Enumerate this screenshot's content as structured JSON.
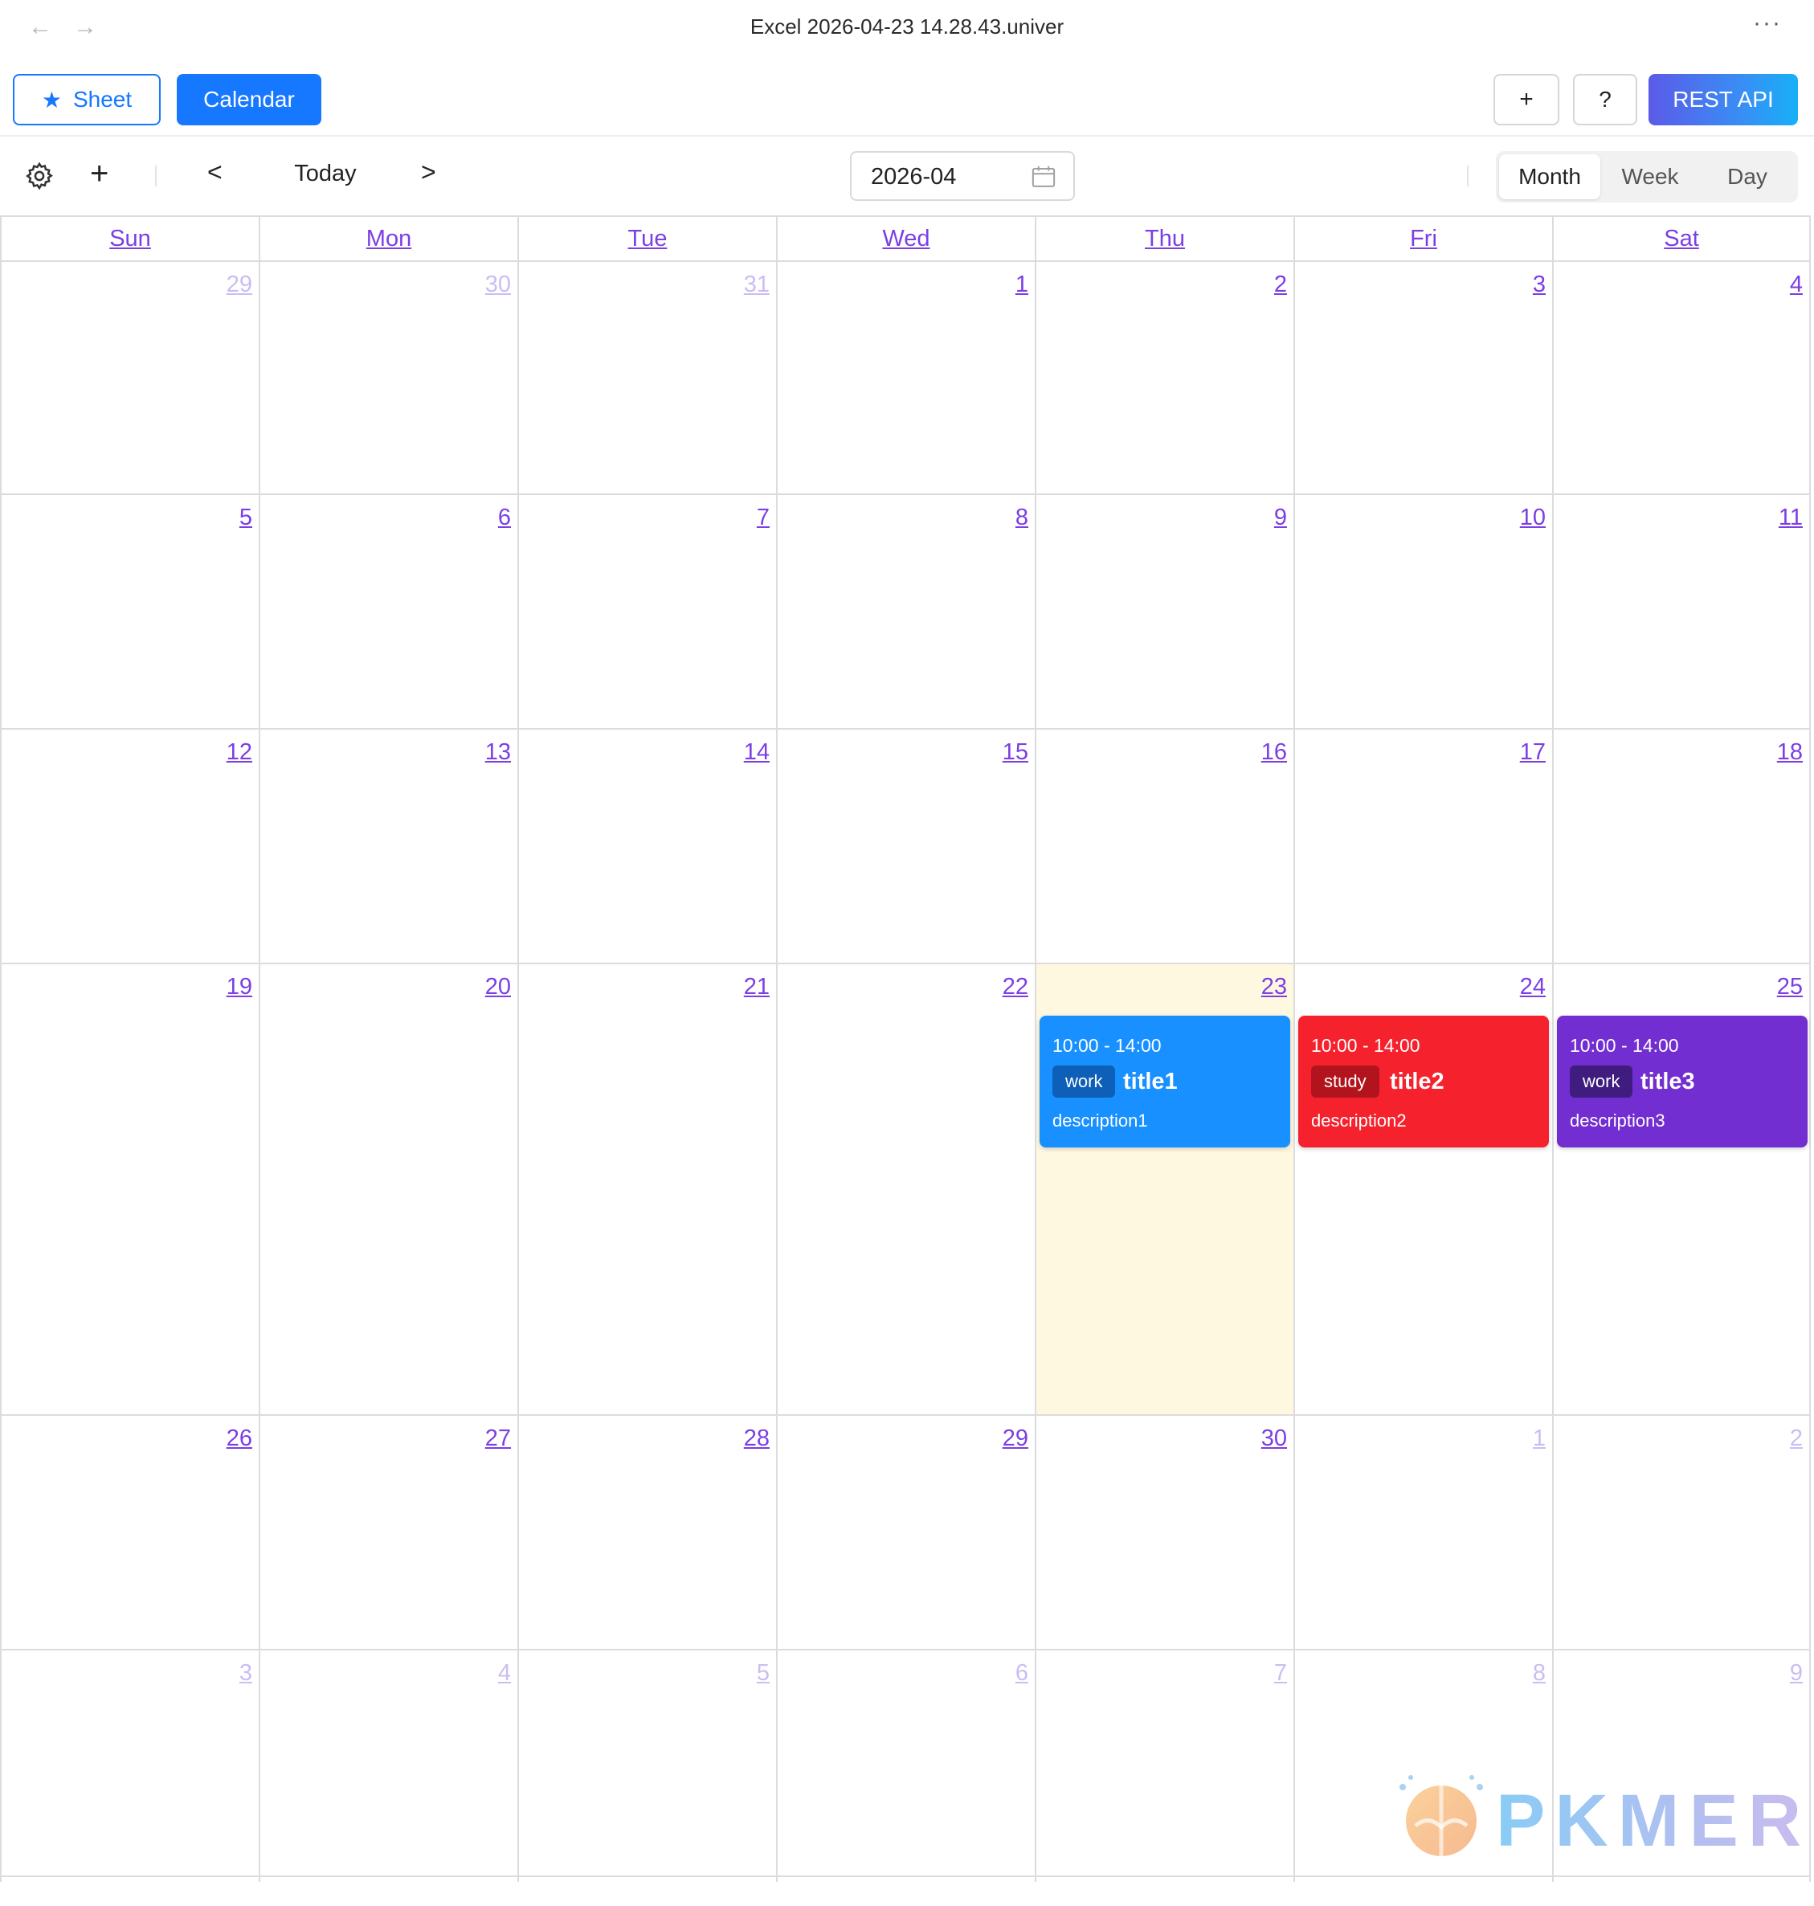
{
  "window": {
    "title": "Excel 2026-04-23 14.28.43.univer",
    "back_icon": "arrow-left-icon",
    "forward_icon": "arrow-right-icon",
    "more_icon": "ellipsis-icon",
    "more_label": "···"
  },
  "toolbar": {
    "sheet_label": "Sheet",
    "calendar_label": "Calendar",
    "add_label": "+",
    "help_label": "?",
    "rest_api_label": "REST API",
    "primary_color": "#1677ff"
  },
  "calendar_controls": {
    "add_label": "+",
    "prev_label": "<",
    "today_label": "Today",
    "next_label": ">",
    "month_value": "2026-04",
    "views": [
      "Month",
      "Week",
      "Day"
    ],
    "active_view": "Month"
  },
  "calendar": {
    "weekdays": [
      "Sun",
      "Mon",
      "Tue",
      "Wed",
      "Thu",
      "Fri",
      "Sat"
    ],
    "today": "23",
    "weeks": [
      [
        {
          "d": "29",
          "m": true
        },
        {
          "d": "30",
          "m": true
        },
        {
          "d": "31",
          "m": true
        },
        {
          "d": "1",
          "m": false
        },
        {
          "d": "2",
          "m": false
        },
        {
          "d": "3",
          "m": false
        },
        {
          "d": "4",
          "m": false
        }
      ],
      [
        {
          "d": "5",
          "m": false
        },
        {
          "d": "6",
          "m": false
        },
        {
          "d": "7",
          "m": false
        },
        {
          "d": "8",
          "m": false
        },
        {
          "d": "9",
          "m": false
        },
        {
          "d": "10",
          "m": false
        },
        {
          "d": "11",
          "m": false
        }
      ],
      [
        {
          "d": "12",
          "m": false
        },
        {
          "d": "13",
          "m": false
        },
        {
          "d": "14",
          "m": false
        },
        {
          "d": "15",
          "m": false
        },
        {
          "d": "16",
          "m": false
        },
        {
          "d": "17",
          "m": false
        },
        {
          "d": "18",
          "m": false
        }
      ],
      [
        {
          "d": "19",
          "m": false
        },
        {
          "d": "20",
          "m": false
        },
        {
          "d": "21",
          "m": false
        },
        {
          "d": "22",
          "m": false
        },
        {
          "d": "23",
          "m": false
        },
        {
          "d": "24",
          "m": false
        },
        {
          "d": "25",
          "m": false
        }
      ],
      [
        {
          "d": "26",
          "m": false
        },
        {
          "d": "27",
          "m": false
        },
        {
          "d": "28",
          "m": false
        },
        {
          "d": "29",
          "m": false
        },
        {
          "d": "30",
          "m": false
        },
        {
          "d": "1",
          "m": true
        },
        {
          "d": "2",
          "m": true
        }
      ],
      [
        {
          "d": "3",
          "m": true
        },
        {
          "d": "4",
          "m": true
        },
        {
          "d": "5",
          "m": true
        },
        {
          "d": "6",
          "m": true
        },
        {
          "d": "7",
          "m": true
        },
        {
          "d": "8",
          "m": true
        },
        {
          "d": "9",
          "m": true
        }
      ]
    ],
    "events": [
      {
        "time": "10:00 - 14:00",
        "tag": "work",
        "title": "title1",
        "description": "description1",
        "color": "#1890ff"
      },
      {
        "time": "10:00 - 14:00",
        "tag": "study",
        "title": "title2",
        "description": "description2",
        "color": "#f5222d"
      },
      {
        "time": "10:00 - 14:00",
        "tag": "work",
        "title": "title3",
        "description": "description3",
        "color": "#722ed1"
      }
    ],
    "day_number_color": "#7b3fe4",
    "today_background": "#fff8e1"
  },
  "watermark": {
    "text": "PKMER"
  }
}
